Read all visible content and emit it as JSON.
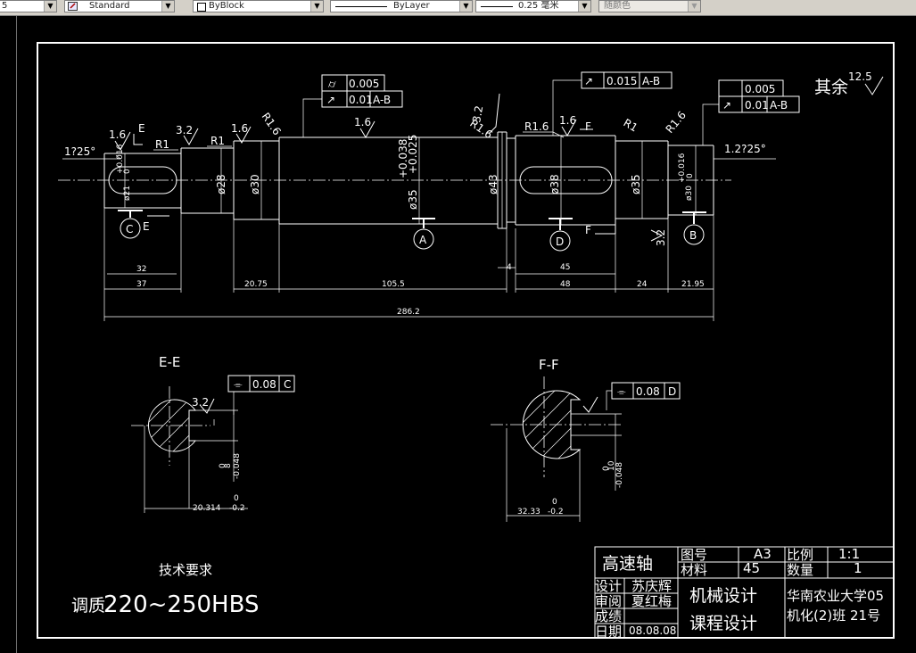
{
  "toolbar": {
    "first_combo": "5",
    "text_style": "Standard",
    "color": "ByBlock",
    "linetype": "ByLayer",
    "lineweight": "0.25 毫米",
    "plotstyle": "随颜色"
  },
  "drawing": {
    "roughness_other": "其余",
    "roughness_other_value": "12.5",
    "shaft": {
      "taper_left": "1?25°",
      "taper_right": "1.2?25°",
      "rough_labels": [
        "1.6",
        "3.2",
        "1.6",
        "1.6",
        "3.2",
        "1.6",
        "1.6",
        "3.2"
      ],
      "radius_labels": [
        "R1",
        "R1",
        "R1.6",
        "R1.6",
        "R1.6",
        "R1",
        "R1.6"
      ],
      "diam_labels": [
        "ø21",
        "ø28",
        "ø30",
        "ø35",
        "ø43",
        "ø38",
        "ø35",
        "ø30"
      ],
      "tol_upper_labels": [
        "+0.016",
        "+0.038",
        "+0.016"
      ],
      "tol_lower_labels": [
        "0",
        "+0.025",
        "0"
      ],
      "section_letters": [
        "E",
        "E",
        "F",
        "F"
      ],
      "datums": [
        "C",
        "A",
        "D",
        "B"
      ],
      "dims": [
        "32",
        "37",
        "20.75",
        "105.5",
        "4",
        "45",
        "48",
        "24",
        "21.95",
        "286.2"
      ]
    },
    "fcf": {
      "left_cyl_sym": "⌭",
      "left_cyl_val": "0.005",
      "left_run_sym": "↗",
      "left_run_val": "0.01",
      "left_run_ref": "A-B",
      "mid_run_val": "0.015",
      "mid_run_ref": "A-B",
      "right_cyl_val": "0.005",
      "right_run_val": "0.01",
      "right_run_ref": "A-B",
      "sym_sym": "⌯",
      "ee_val": "0.08",
      "ee_ref": "C",
      "ff_val": "0.08",
      "ff_ref": "D"
    },
    "section_ee": {
      "title": "E-E",
      "rough": "3.2",
      "width_main": "8",
      "width_tol_up": "0",
      "width_tol_lo": "-0.048",
      "depth_main": "20.314",
      "depth_tol_up": "0",
      "depth_tol_lo": "-0.2"
    },
    "section_ff": {
      "title": "F-F",
      "width_main": "10",
      "width_tol_up": "0",
      "width_tol_lo": "-0.048",
      "depth_main": "32.33",
      "depth_tol_up": "0",
      "depth_tol_lo": "-0.2"
    },
    "tech": {
      "heading": "技术要求",
      "text_prefix": "调质",
      "text_value": "220~250HBS"
    },
    "title_block": {
      "part_name": "高速轴",
      "drawing_no_label": "图号",
      "drawing_no": "A3",
      "scale_label": "比例",
      "scale": "1:1",
      "material_label": "材料",
      "material": "45",
      "qty_label": "数量",
      "qty": "1",
      "design_label": "设计",
      "designer": "苏庆辉",
      "review_label": "审阅",
      "reviewer": "夏红梅",
      "grade_label": "成绩",
      "date_label": "日期",
      "date": "08.08.08",
      "course1": "机械设计",
      "course2": "课程设计",
      "school1": "华南农业大学05",
      "school2": "机化(2)班 21号"
    }
  }
}
